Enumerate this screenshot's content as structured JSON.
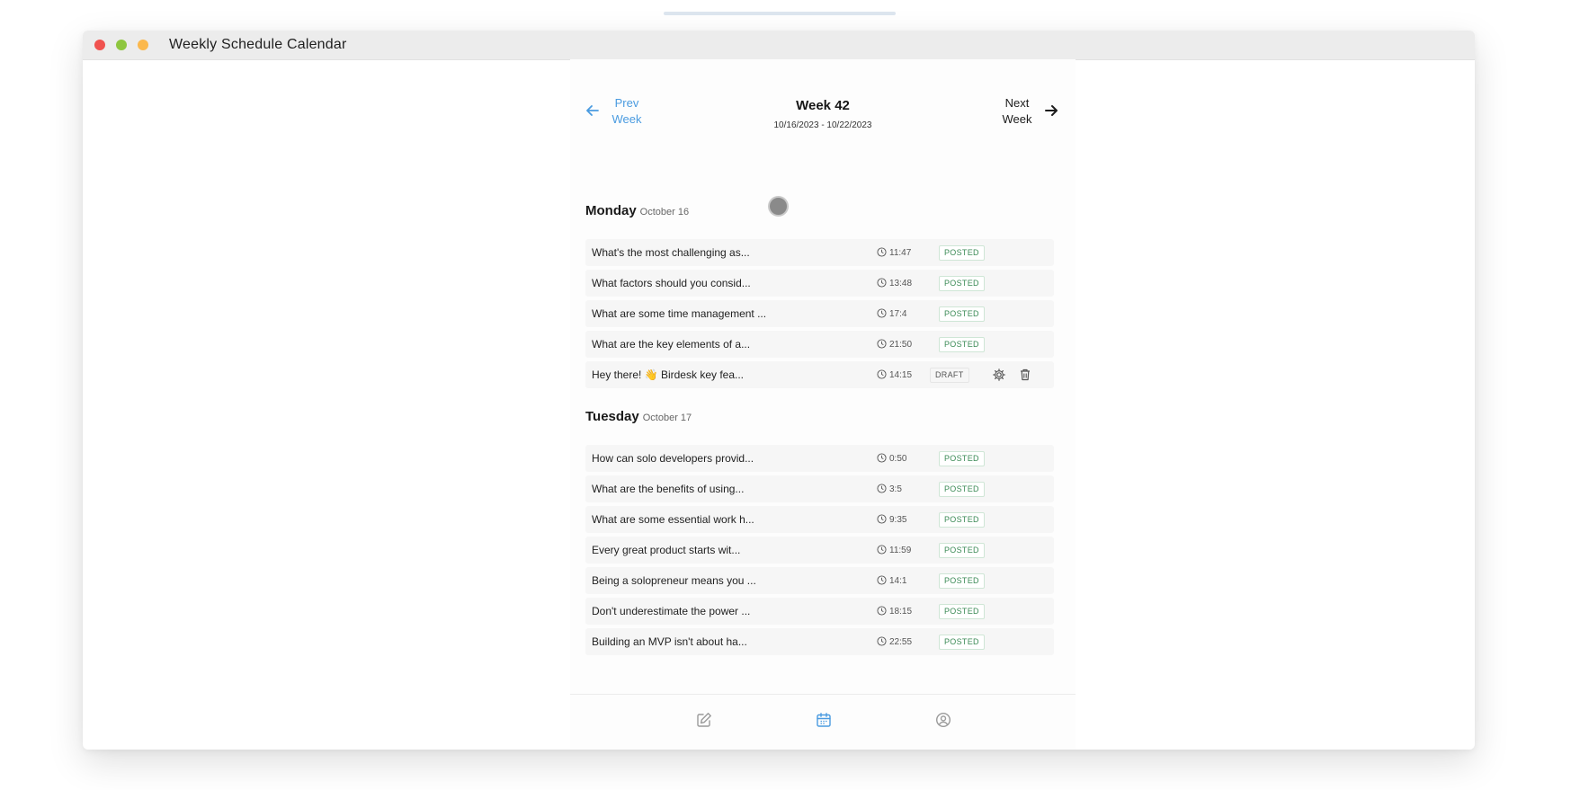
{
  "window": {
    "title": "Weekly Schedule Calendar"
  },
  "week_nav": {
    "prev_line1": "Prev",
    "prev_line2": "Week",
    "next_line1": "Next",
    "next_line2": "Week",
    "title": "Week 42",
    "range": "10/16/2023 - 10/22/2023"
  },
  "days": [
    {
      "name": "Monday",
      "date": "October 16",
      "posts": [
        {
          "text": "What's the most challenging as...",
          "time": "11:47",
          "status": "POSTED"
        },
        {
          "text": "What factors should you consid...",
          "time": "13:48",
          "status": "POSTED"
        },
        {
          "text": "What are some time management ...",
          "time": "17:4",
          "status": "POSTED"
        },
        {
          "text": "What are the key elements of a...",
          "time": "21:50",
          "status": "POSTED"
        },
        {
          "text": "Hey there! 👋 Birdesk key fea...",
          "time": "14:15",
          "status": "DRAFT"
        }
      ]
    },
    {
      "name": "Tuesday",
      "date": "October 17",
      "posts": [
        {
          "text": "How can solo developers provid...",
          "time": "0:50",
          "status": "POSTED"
        },
        {
          "text": "What are the benefits of using...",
          "time": "3:5",
          "status": "POSTED"
        },
        {
          "text": "What are some essential work h...",
          "time": "9:35",
          "status": "POSTED"
        },
        {
          "text": "Every great product starts wit...",
          "time": "11:59",
          "status": "POSTED"
        },
        {
          "text": "Being a solopreneur means you ...",
          "time": "14:1",
          "status": "POSTED"
        },
        {
          "text": "Don't underestimate the power ...",
          "time": "18:15",
          "status": "POSTED"
        },
        {
          "text": "Building an MVP isn't about ha...",
          "time": "22:55",
          "status": "POSTED"
        }
      ]
    }
  ],
  "bottom_tabs": [
    {
      "icon": "edit-icon",
      "active": false
    },
    {
      "icon": "calendar-icon",
      "active": true
    },
    {
      "icon": "user-circle-icon",
      "active": false
    }
  ],
  "colors": {
    "accent": "#4a9be0",
    "posted": "#3a8a55",
    "row_bg": "#f6f6f6"
  }
}
